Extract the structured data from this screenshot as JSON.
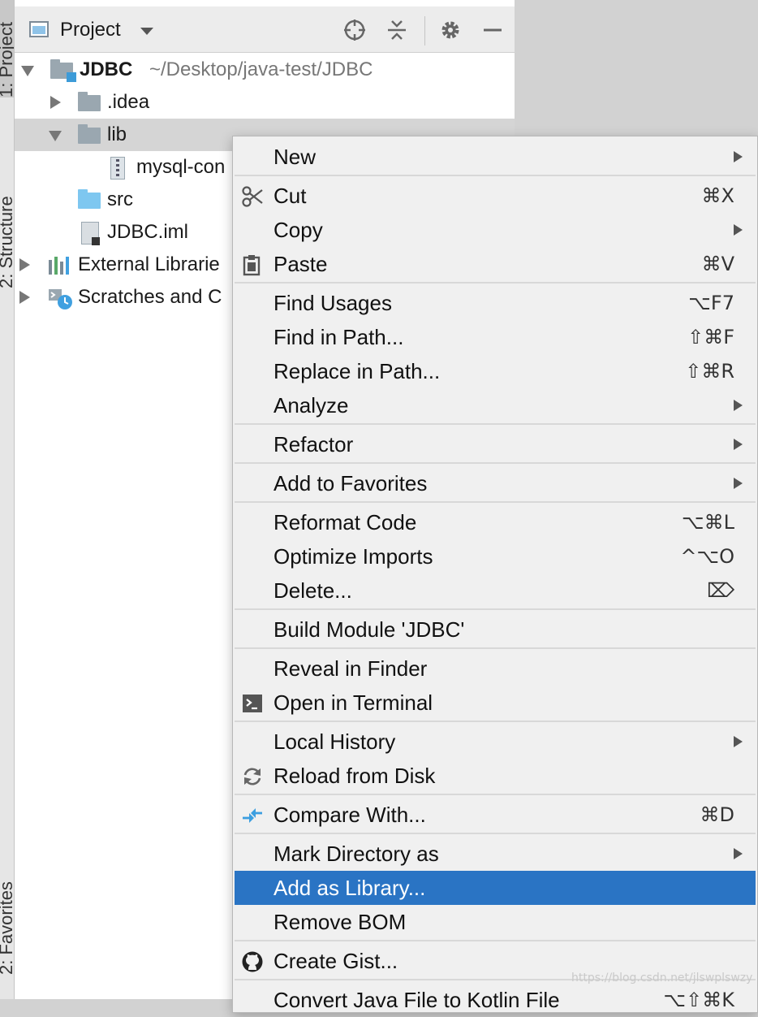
{
  "tool_strip": {
    "tabs": [
      "1: Project",
      "2: Structure",
      "2: Favorites"
    ]
  },
  "project_panel": {
    "title": "Project",
    "tree": [
      {
        "label": "JDBC",
        "path": "~/Desktop/java-test/JDBC"
      },
      {
        "label": ".idea"
      },
      {
        "label": "lib"
      },
      {
        "label": "mysql-con"
      },
      {
        "label": "src"
      },
      {
        "label": "JDBC.iml"
      },
      {
        "label": "External Librarie"
      },
      {
        "label": "Scratches and C"
      }
    ]
  },
  "context_menu": {
    "items": [
      {
        "label": "New",
        "shortcut": ""
      },
      {
        "label": "Cut",
        "shortcut": "⌘X"
      },
      {
        "label": "Copy",
        "shortcut": ""
      },
      {
        "label": "Paste",
        "shortcut": "⌘V"
      },
      {
        "label": "Find Usages",
        "shortcut": "⌥F7"
      },
      {
        "label": "Find in Path...",
        "shortcut": "⇧⌘F"
      },
      {
        "label": "Replace in Path...",
        "shortcut": "⇧⌘R"
      },
      {
        "label": "Analyze",
        "shortcut": ""
      },
      {
        "label": "Refactor",
        "shortcut": ""
      },
      {
        "label": "Add to Favorites",
        "shortcut": ""
      },
      {
        "label": "Reformat Code",
        "shortcut": "⌥⌘L"
      },
      {
        "label": "Optimize Imports",
        "shortcut": "^⌥O"
      },
      {
        "label": "Delete...",
        "shortcut": "⌦"
      },
      {
        "label": "Build Module 'JDBC'",
        "shortcut": ""
      },
      {
        "label": "Reveal in Finder",
        "shortcut": ""
      },
      {
        "label": "Open in Terminal",
        "shortcut": ""
      },
      {
        "label": "Local History",
        "shortcut": ""
      },
      {
        "label": "Reload from Disk",
        "shortcut": ""
      },
      {
        "label": "Compare With...",
        "shortcut": "⌘D"
      },
      {
        "label": "Mark Directory as",
        "shortcut": ""
      },
      {
        "label": "Add as Library...",
        "shortcut": ""
      },
      {
        "label": "Remove BOM",
        "shortcut": ""
      },
      {
        "label": "Create Gist...",
        "shortcut": ""
      },
      {
        "label": "Convert Java File to Kotlin File",
        "shortcut": "⌥⇧⌘K"
      }
    ]
  },
  "watermark": "https://blog.csdn.net/jlswplswzy",
  "colors": {
    "highlight": "#2a74c4",
    "menu_bg": "#f0f0f0",
    "folder": "#9aa7b0",
    "source_folder": "#7ec7f0"
  }
}
